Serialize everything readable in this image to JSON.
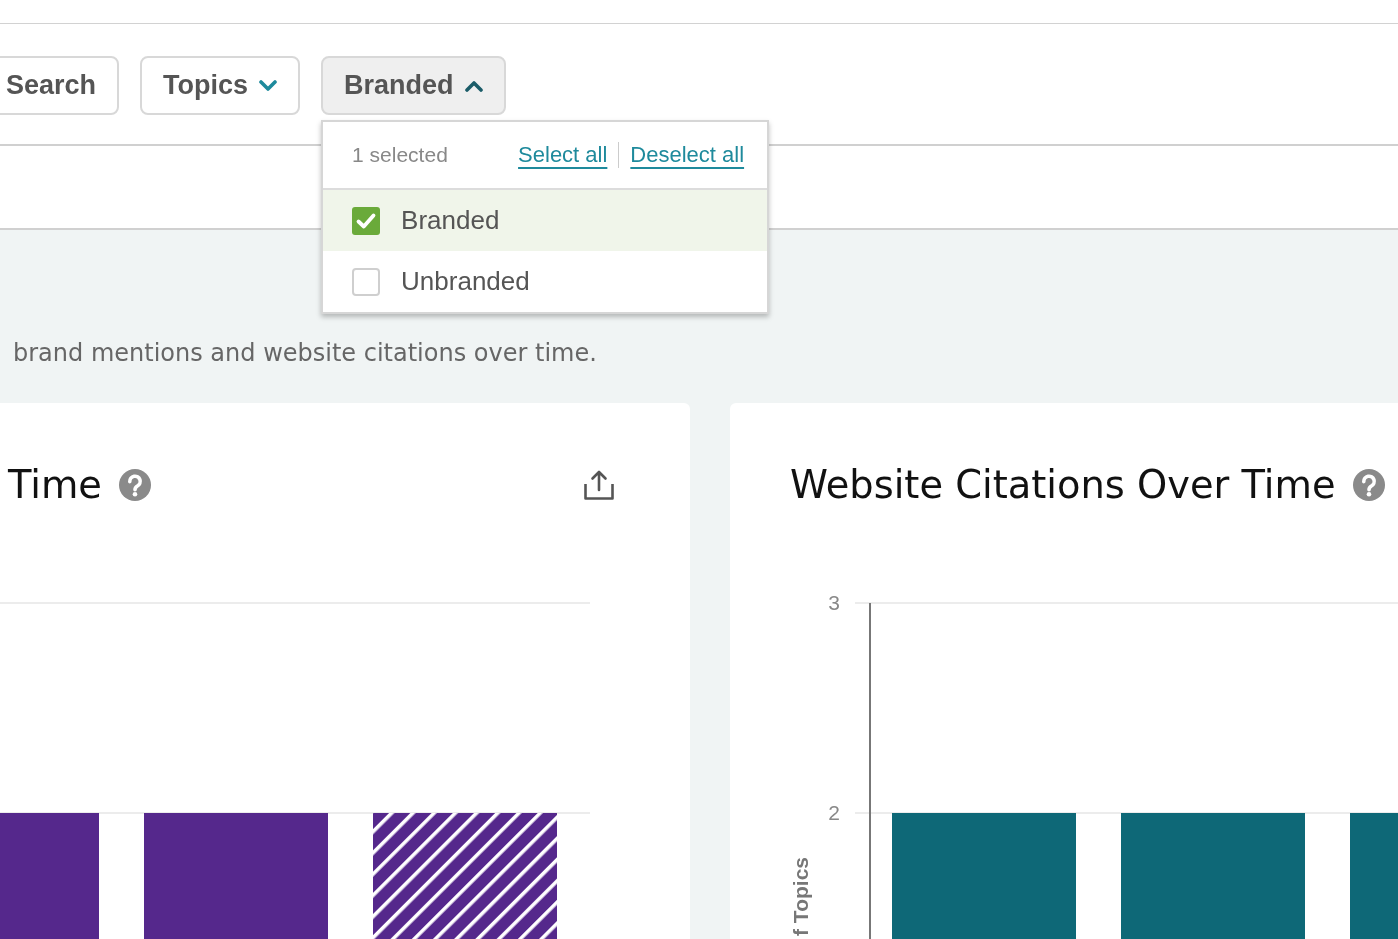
{
  "filters": [
    {
      "label": "Search",
      "kind": "button",
      "expanded": false
    },
    {
      "label": "Topics",
      "kind": "dropdown",
      "expanded": false
    },
    {
      "label": "Branded",
      "kind": "dropdown",
      "expanded": true,
      "dropdown": {
        "summary": "1 selected",
        "select_all": "Select all",
        "deselect_all": "Deselect all",
        "options": [
          {
            "label": "Branded",
            "checked": true
          },
          {
            "label": "Unbranded",
            "checked": false
          }
        ]
      }
    }
  ],
  "description": "brand mentions and website citations over time.",
  "cards": [
    {
      "title": "Time",
      "export_button": true,
      "bars": [
        {
          "kind": "solid"
        },
        {
          "kind": "solid"
        },
        {
          "kind": "hatched"
        }
      ]
    },
    {
      "title": "Website Citations Over Time",
      "chart_data": [
        {
          "type": "bar",
          "ylabel": "f Topics",
          "categories": [
            null,
            null,
            null
          ],
          "values": [
            2,
            2,
            2
          ],
          "color": "#0e6877",
          "yticks": [
            2,
            3
          ],
          "ylim": [
            1.4,
            3
          ]
        }
      ]
    }
  ]
}
